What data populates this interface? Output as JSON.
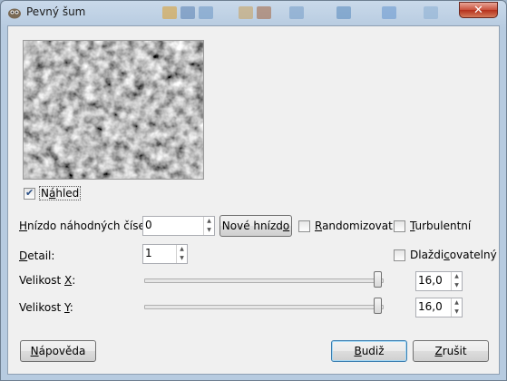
{
  "window": {
    "title": "Pevný šum",
    "close_symbol": "✕"
  },
  "preview": {
    "checkbox_label_prefix": "N",
    "checkbox_label_accel": "á",
    "checkbox_label_suffix": "hled",
    "checked": true
  },
  "seed": {
    "label_accel": "H",
    "label_rest": "nízdo náhodných čísel:",
    "value": "0",
    "new_seed_prefix": "Nové hnízd",
    "new_seed_accel": "o",
    "randomize_accel": "R",
    "randomize_rest": "andomizovat",
    "randomize_checked": false,
    "turbulent_accel": "T",
    "turbulent_rest": "urbulentní",
    "turbulent_checked": false
  },
  "detail": {
    "label_accel": "D",
    "label_rest": "etail:",
    "value": "1",
    "tileable_prefix": "Dlaždi",
    "tileable_accel": "c",
    "tileable_suffix": "ovatelný",
    "tileable_checked": false
  },
  "size_x": {
    "label_prefix": "Velikost ",
    "label_accel": "X",
    "label_suffix": ":",
    "value": "16,0",
    "fraction": 1.0
  },
  "size_y": {
    "label_prefix": "Velikost ",
    "label_accel": "Y",
    "label_suffix": ":",
    "value": "16,0",
    "fraction": 1.0
  },
  "buttons": {
    "help_accel": "N",
    "help_rest": "ápověda",
    "ok_accel": "B",
    "ok_rest": "udiž",
    "cancel_accel": "Z",
    "cancel_rest": "rušit"
  },
  "colors": {
    "default_button_border": "#3c7fb1",
    "checkmark": "#2a4f86"
  },
  "icons": {
    "window": "gimp-icon",
    "close": "close-icon",
    "spin": "spin-arrows-icon"
  }
}
